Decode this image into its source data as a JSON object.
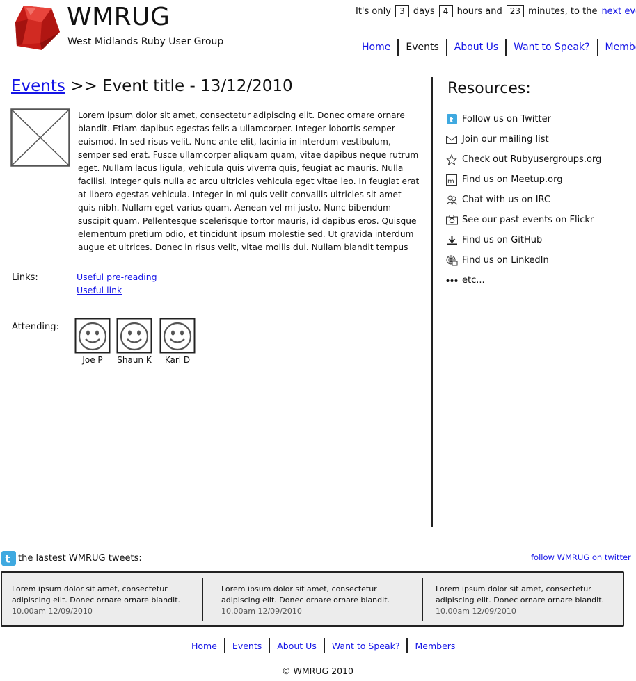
{
  "header": {
    "title": "WMRUG",
    "subtitle": "West Midlands Ruby User Group",
    "countdown": {
      "prefix": "It's only",
      "days": "3",
      "days_label": "days",
      "hours": "4",
      "hours_label": "hours and",
      "minutes": "23",
      "minutes_label": "minutes, to the",
      "link": "next event!"
    }
  },
  "nav": {
    "home": "Home",
    "events": "Events",
    "about": "About Us",
    "speak": "Want to Speak?",
    "members": "Members"
  },
  "main": {
    "breadcrumb_link": "Events",
    "title": ">> Event title - 13/12/2010",
    "body": "Lorem ipsum dolor sit amet, consectetur adipiscing elit. Donec ornare ornare blandit. Etiam dapibus egestas felis a ullamcorper. Integer lobortis semper euismod. In sed risus velit. Nunc ante elit, lacinia in interdum vestibulum, semper sed erat. Fusce ullamcorper aliquam quam, vitae dapibus neque rutrum eget. Nullam lacus ligula, vehicula quis viverra quis, feugiat ac mauris. Nulla facilisi. Integer quis nulla ac arcu ultricies vehicula eget vitae leo. In feugiat erat at libero egestas vehicula. Integer in mi quis velit convallis ultricies sit amet quis nibh. Nullam eget varius quam. Aenean vel mi justo. Nunc bibendum suscipit quam. Pellentesque scelerisque tortor mauris, id dapibus eros. Quisque elementum pretium odio, et tincidunt ipsum molestie sed. Ut gravida interdum augue et ultrices. Donec in risus velit, vitae mollis dui. Nullam blandit tempus",
    "links_label": "Links:",
    "links": [
      "Useful pre-reading",
      "Useful link"
    ],
    "attending_label": "Attending:",
    "attendees": [
      "Joe P",
      "Shaun K",
      "Karl D"
    ]
  },
  "resources": {
    "title": "Resources:",
    "items": [
      {
        "label": "Follow us on Twitter",
        "icon": "twitter-icon"
      },
      {
        "label": "Join our mailing list",
        "icon": "mail-icon"
      },
      {
        "label": "Check out Rubyusergroups.org",
        "icon": "star-icon"
      },
      {
        "label": "Find us on Meetup.org",
        "icon": "meetup-icon"
      },
      {
        "label": "Chat with us on IRC",
        "icon": "chat-icon"
      },
      {
        "label": "See our past events on Flickr",
        "icon": "camera-icon"
      },
      {
        "label": "Find us on GitHub",
        "icon": "download-icon"
      },
      {
        "label": "Find us on LinkedIn",
        "icon": "linkedin-icon"
      },
      {
        "label": "etc...",
        "icon": "ellipsis-icon"
      }
    ]
  },
  "tweets": {
    "header": "the lastest WMRUG tweets:",
    "follow_link": "follow WMRUG on twitter",
    "items": [
      {
        "text": "Lorem ipsum dolor sit amet, consectetur adipiscing elit. Donec ornare ornare blandit.",
        "meta": "10.00am 12/09/2010"
      },
      {
        "text": "Lorem ipsum dolor sit amet, consectetur adipiscing elit. Donec ornare ornare blandit.",
        "meta": "10.00am 12/09/2010"
      },
      {
        "text": "Lorem ipsum dolor sit amet, consectetur adipiscing elit. Donec ornare ornare blandit.",
        "meta": "10.00am 12/09/2010"
      }
    ]
  },
  "footer": {
    "copyright": "© WMRUG 2010"
  },
  "colors": {
    "link": "#1515e6",
    "logo_red": "#c41a16",
    "twitter_blue": "#3fa9e0",
    "tweets_bg": "#ececec"
  }
}
